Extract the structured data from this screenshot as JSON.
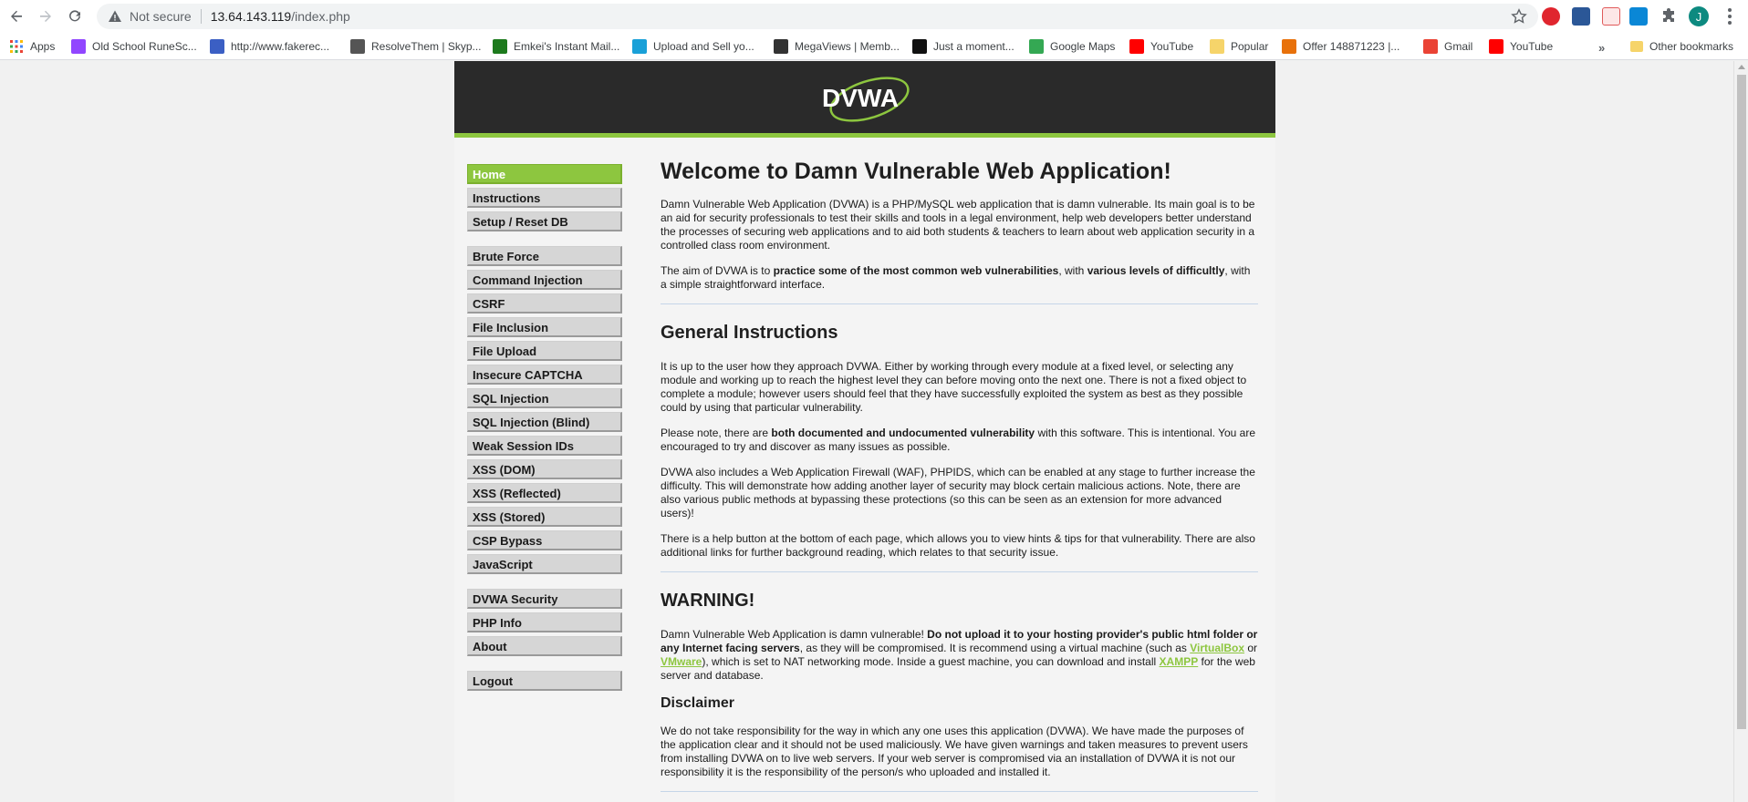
{
  "browser": {
    "security_label": "Not secure",
    "url_host": "13.64.143.119",
    "url_path": "/index.php",
    "profile_initial": "J"
  },
  "bookmarks": {
    "apps_label": "Apps",
    "items": [
      {
        "label": "Old School RuneSc...",
        "icon": "twitch-icon",
        "color": "#9146ff"
      },
      {
        "label": "http://www.fakerec...",
        "icon": "fr-icon",
        "color": "#3b5fc4"
      },
      {
        "label": "ResolveThem | Skyp...",
        "icon": "skull-icon",
        "color": "#555555"
      },
      {
        "label": "Emkei's Instant Mail...",
        "icon": "emkei-icon",
        "color": "#1d7a1d"
      },
      {
        "label": "Upload and Sell yo...",
        "icon": "shield-icon",
        "color": "#19a0d8"
      },
      {
        "label": "MegaViews | Memb...",
        "icon": "megaviews-icon",
        "color": "#333333"
      },
      {
        "label": "Just a moment...",
        "icon": "terminal-icon",
        "color": "#111111"
      },
      {
        "label": "Google Maps",
        "icon": "maps-icon",
        "color": "#34a853"
      },
      {
        "label": "YouTube",
        "icon": "youtube-icon",
        "color": "#ff0000"
      },
      {
        "label": "Popular",
        "icon": "folder-icon",
        "color": "#f6d46a"
      },
      {
        "label": "Offer 148871223 |...",
        "icon": "offer-icon",
        "color": "#e8710a"
      },
      {
        "label": "Gmail",
        "icon": "gmail-icon",
        "color": "#ea4335"
      },
      {
        "label": "YouTube",
        "icon": "youtube-icon",
        "color": "#ff0000"
      }
    ],
    "more_label": "»",
    "other_label": "Other bookmarks"
  },
  "site": {
    "logo_text": "DVWA",
    "accent_color": "#8dc63f"
  },
  "menu": {
    "groups": [
      [
        "Home",
        "Instructions",
        "Setup / Reset DB"
      ],
      [
        "Brute Force",
        "Command Injection",
        "CSRF",
        "File Inclusion",
        "File Upload",
        "Insecure CAPTCHA",
        "SQL Injection",
        "SQL Injection (Blind)",
        "Weak Session IDs",
        "XSS (DOM)",
        "XSS (Reflected)",
        "XSS (Stored)",
        "CSP Bypass",
        "JavaScript"
      ],
      [
        "DVWA Security",
        "PHP Info",
        "About"
      ],
      [
        "Logout"
      ]
    ],
    "selected": "Home"
  },
  "main": {
    "title": "Welcome to Damn Vulnerable Web Application!",
    "intro": "Damn Vulnerable Web Application (DVWA) is a PHP/MySQL web application that is damn vulnerable. Its main goal is to be an aid for security professionals to test their skills and tools in a legal environment, help web developers better understand the processes of securing web applications and to aid both students & teachers to learn about web application security in a controlled class room environment.",
    "aim_pre": "The aim of DVWA is to ",
    "aim_bold1": "practice some of the most common web vulnerabilities",
    "aim_mid": ", with ",
    "aim_bold2": "various levels of difficultly",
    "aim_post": ", with a simple straightforward interface.",
    "gi_title": "General Instructions",
    "gi_p1": "It is up to the user how they approach DVWA. Either by working through every module at a fixed level, or selecting any module and working up to reach the highest level they can before moving onto the next one. There is not a fixed object to complete a module; however users should feel that they have successfully exploited the system as best as they possible could by using that particular vulnerability.",
    "gi_p2_pre": "Please note, there are ",
    "gi_p2_bold": "both documented and undocumented vulnerability",
    "gi_p2_post": " with this software. This is intentional. You are encouraged to try and discover as many issues as possible.",
    "gi_p3": "DVWA also includes a Web Application Firewall (WAF), PHPIDS, which can be enabled at any stage to further increase the difficulty. This will demonstrate how adding another layer of security may block certain malicious actions. Note, there are also various public methods at bypassing these protections (so this can be seen as an extension for more advanced users)!",
    "gi_p4": "There is a help button at the bottom of each page, which allows you to view hints & tips for that vulnerability. There are also additional links for further background reading, which relates to that security issue.",
    "warn_title": "WARNING!",
    "warn_pre": "Damn Vulnerable Web Application is damn vulnerable! ",
    "warn_bold": "Do not upload it to your hosting provider's public html folder or any Internet facing servers",
    "warn_mid1": ", as they will be compromised. It is recommend using a virtual machine (such as ",
    "warn_link1": "VirtualBox",
    "warn_or": " or ",
    "warn_link2": "VMware",
    "warn_mid2": "), which is set to NAT networking mode. Inside a guest machine, you can download and install ",
    "warn_link3": "XAMPP",
    "warn_post": " for the web server and database.",
    "disc_title": "Disclaimer",
    "disc_p": "We do not take responsibility for the way in which any one uses this application (DVWA). We have made the purposes of the application clear and it should not be used maliciously. We have given warnings and taken measures to prevent users from installing DVWA on to live web servers. If your web server is compromised via an installation of DVWA it is not our responsibility it is the responsibility of the person/s who uploaded and installed it."
  }
}
